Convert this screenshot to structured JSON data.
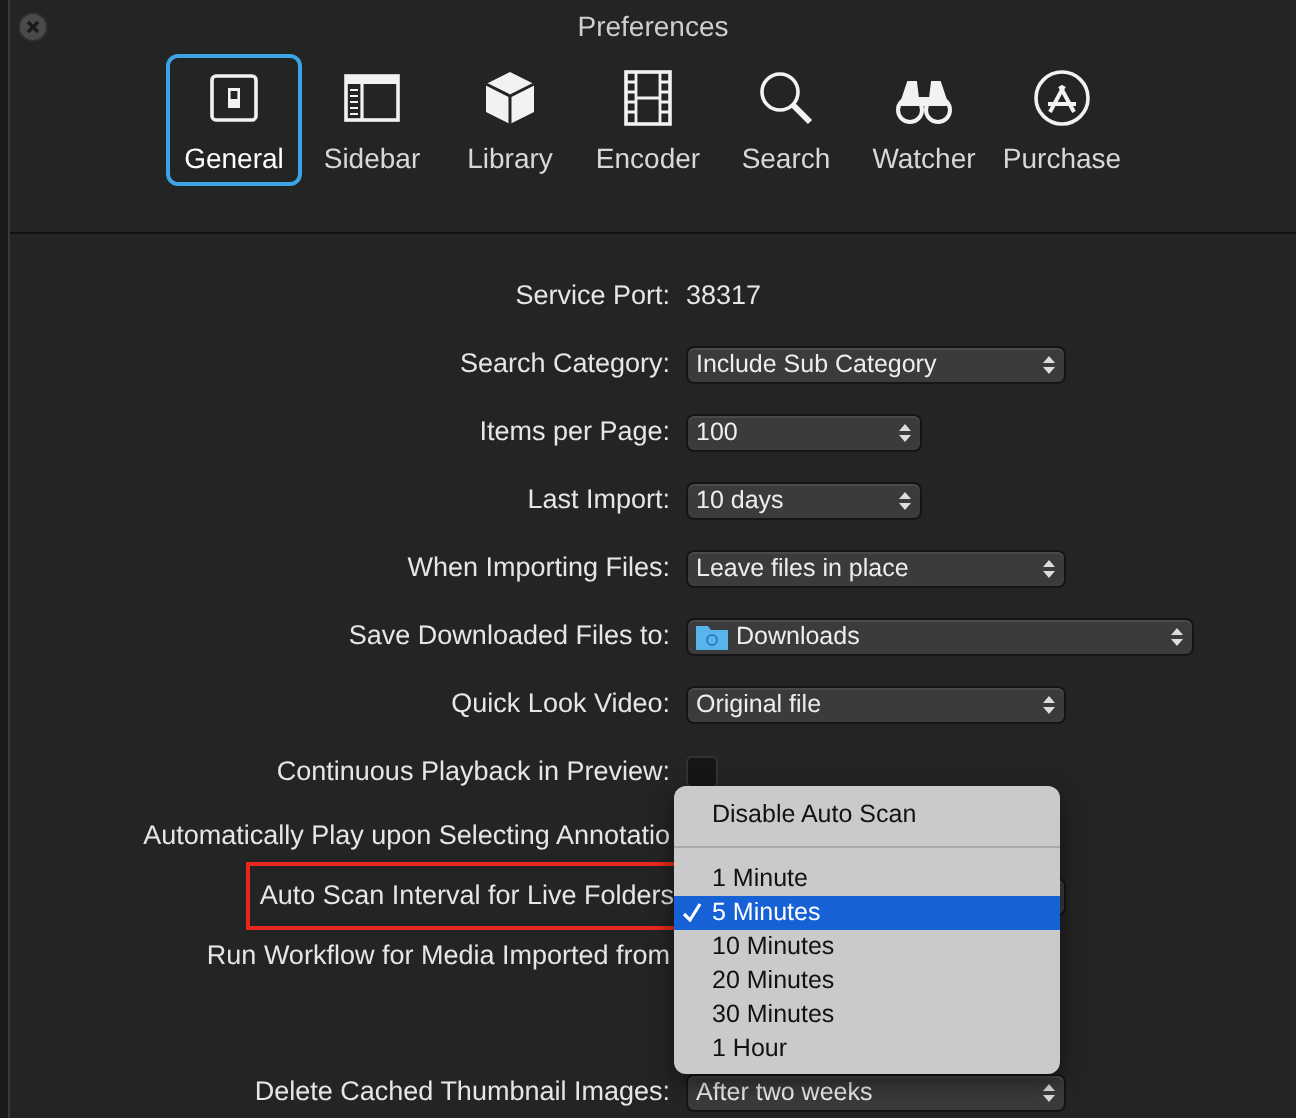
{
  "window": {
    "title": "Preferences"
  },
  "toolbar": [
    {
      "label": "General",
      "kind": "general",
      "selected": true
    },
    {
      "label": "Sidebar",
      "kind": "sidebar",
      "selected": false
    },
    {
      "label": "Library",
      "kind": "library",
      "selected": false
    },
    {
      "label": "Encoder",
      "kind": "encoder",
      "selected": false
    },
    {
      "label": "Search",
      "kind": "search",
      "selected": false
    },
    {
      "label": "Watcher",
      "kind": "watcher",
      "selected": false
    },
    {
      "label": "Purchase",
      "kind": "purchase",
      "selected": false
    }
  ],
  "settings": [
    {
      "label": "Service Port:",
      "kind": "text",
      "value": "38317"
    },
    {
      "label": "Search Category:",
      "kind": "select",
      "value": "Include Sub Category"
    },
    {
      "label": "Items per Page:",
      "kind": "short-select",
      "value": "100"
    },
    {
      "label": "Last Import:",
      "kind": "short-select",
      "value": "10 days"
    },
    {
      "label": "When Importing Files:",
      "kind": "select",
      "value": "Leave files in place"
    },
    {
      "label": "Save Downloaded Files to:",
      "kind": "folder-select",
      "value": "Downloads"
    },
    {
      "label": "Quick Look Video:",
      "kind": "select",
      "value": "Original file"
    },
    {
      "label": "Continuous Playback in Preview:",
      "kind": "checkbox",
      "checked": false
    },
    {
      "label": "Automatically Play upon Selecting Annotatio",
      "kind": "label"
    },
    {
      "label": "Auto Scan Interval for Live Folders",
      "kind": "select",
      "highlighted": true
    },
    {
      "label": "Run Workflow for Media Imported from",
      "kind": "label"
    },
    {
      "label": "Delete Cached Thumbnail Images:",
      "kind": "select",
      "value": "After two weeks"
    }
  ],
  "popup_menu": {
    "items": [
      {
        "kind": "item",
        "label": "Disable Auto Scan",
        "selected": false
      },
      {
        "kind": "separator"
      },
      {
        "kind": "item",
        "label": "1 Minute",
        "selected": false
      },
      {
        "kind": "item",
        "label": "5 Minutes",
        "selected": true
      },
      {
        "kind": "item",
        "label": "10 Minutes",
        "selected": false
      },
      {
        "kind": "item",
        "label": "20 Minutes",
        "selected": false
      },
      {
        "kind": "item",
        "label": "30 Minutes",
        "selected": false
      },
      {
        "kind": "item",
        "label": "1 Hour",
        "selected": false
      }
    ]
  }
}
